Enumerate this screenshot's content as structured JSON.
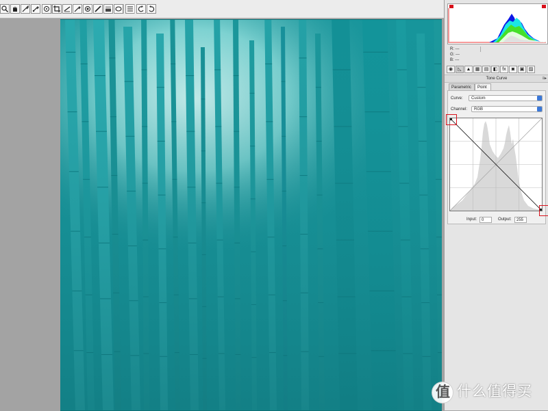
{
  "toolbar": {
    "tools": [
      {
        "name": "zoom-tool-icon",
        "glyph": "zoom"
      },
      {
        "name": "hand-tool-icon",
        "glyph": "hand"
      },
      {
        "name": "white-balance-tool-icon",
        "glyph": "wb"
      },
      {
        "name": "color-sampler-tool-icon",
        "glyph": "sampler"
      },
      {
        "name": "targeted-adjustment-tool-icon",
        "glyph": "tat"
      },
      {
        "name": "crop-tool-icon",
        "glyph": "crop"
      },
      {
        "name": "straighten-tool-icon",
        "glyph": "straighten"
      },
      {
        "name": "spot-removal-tool-icon",
        "glyph": "spot"
      },
      {
        "name": "red-eye-tool-icon",
        "glyph": "redeye"
      },
      {
        "name": "adjustment-brush-icon",
        "glyph": "brush"
      },
      {
        "name": "graduated-filter-icon",
        "glyph": "grad"
      },
      {
        "name": "radial-filter-icon",
        "glyph": "radial"
      },
      {
        "name": "preferences-icon",
        "glyph": "list"
      },
      {
        "name": "rotate-ccw-icon",
        "glyph": "rotl"
      },
      {
        "name": "rotate-cw-icon",
        "glyph": "rotr"
      }
    ]
  },
  "readout": {
    "r": "R:  ---",
    "g": "G:  ---",
    "b": "B:  ---"
  },
  "panel": {
    "title": "Tone Curve",
    "menu": "≡▸",
    "tabs": {
      "parametric": "Parametric",
      "point": "Point"
    },
    "curve_label": "Curve:",
    "curve_value": "Custom",
    "channel_label": "Channel:",
    "channel_value": "RGB",
    "input_label": "Input:",
    "input_value": "0",
    "output_label": "Output:",
    "output_value": "255",
    "icon_tabs": [
      "◉",
      "◺",
      "▲",
      "▦",
      "▤",
      "◧",
      "fx",
      "◙",
      "▣",
      "▨"
    ]
  },
  "colors": {
    "photo_base": "#148c92",
    "highlight_marker": "#d8101a",
    "select_accent": "#3b78d8"
  },
  "watermark": {
    "logo": "值",
    "text": "什么值得买"
  }
}
